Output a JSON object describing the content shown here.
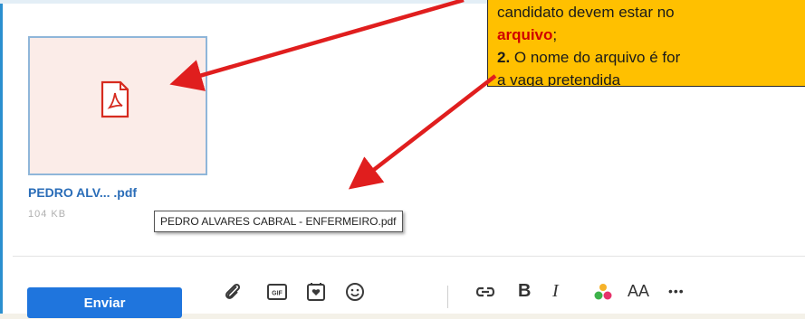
{
  "attachment": {
    "file_name_short": "PEDRO ALV... .pdf",
    "file_size": "104 KB",
    "tooltip_full_name": "PEDRO ALVARES CABRAL - ENFERMEIRO.pdf",
    "icon": "pdf-icon"
  },
  "callout": {
    "line1": "candidato devem estar no",
    "line2_highlight": "arquivo",
    "line2_rest": ";",
    "item2_number": "2.",
    "item2_text": " O nome do arquivo é for",
    "line4": "a vaga pretendida"
  },
  "composer": {
    "send_label": "Enviar",
    "tools": [
      {
        "name": "attach-icon"
      },
      {
        "name": "gif-icon",
        "label": "GIF"
      },
      {
        "name": "sticker-icon"
      },
      {
        "name": "emoji-icon"
      },
      {
        "name": "link-icon"
      },
      {
        "name": "bold-icon",
        "label": "B"
      },
      {
        "name": "italic-icon",
        "label": "I"
      },
      {
        "name": "color-icon"
      },
      {
        "name": "font-size-icon",
        "label": "AA"
      },
      {
        "name": "more-icon",
        "label": "•••"
      }
    ]
  },
  "colors": {
    "accent": "#1f75dd",
    "callout_bg": "#ffc000",
    "arrow": "#e01e1e",
    "pdf_red": "#d62b1f"
  }
}
